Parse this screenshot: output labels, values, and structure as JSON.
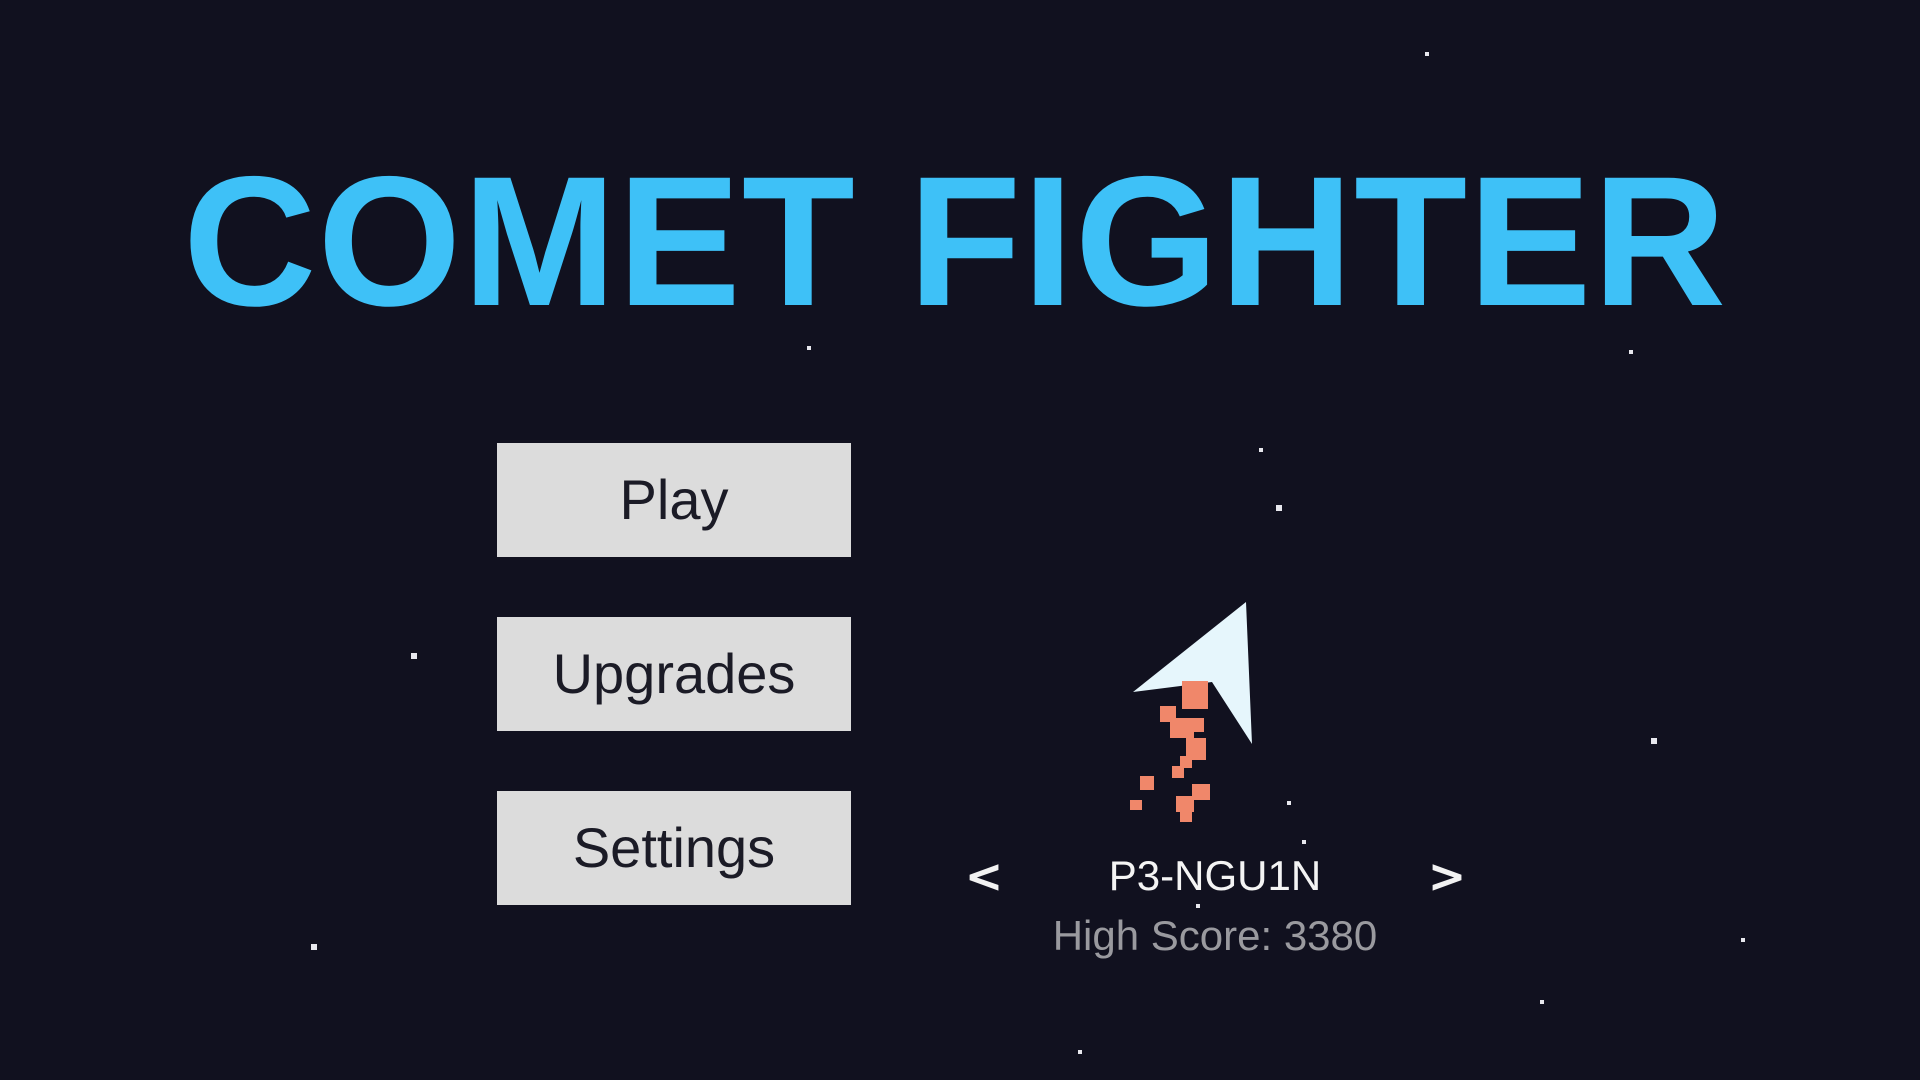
{
  "game": {
    "title": "COMET FIGHTER"
  },
  "menu": {
    "play_label": "Play",
    "upgrades_label": "Upgrades",
    "settings_label": "Settings"
  },
  "ship_selector": {
    "prev_label": "<",
    "next_label": ">",
    "ship_name": "P3-NGU1N",
    "high_score_text": "High Score: 3380"
  },
  "colors": {
    "background": "#11111f",
    "title": "#3ec1f7",
    "button_bg": "#dcdcdc",
    "ship_body": "#e6f6fc",
    "thruster": "#f0876a"
  }
}
